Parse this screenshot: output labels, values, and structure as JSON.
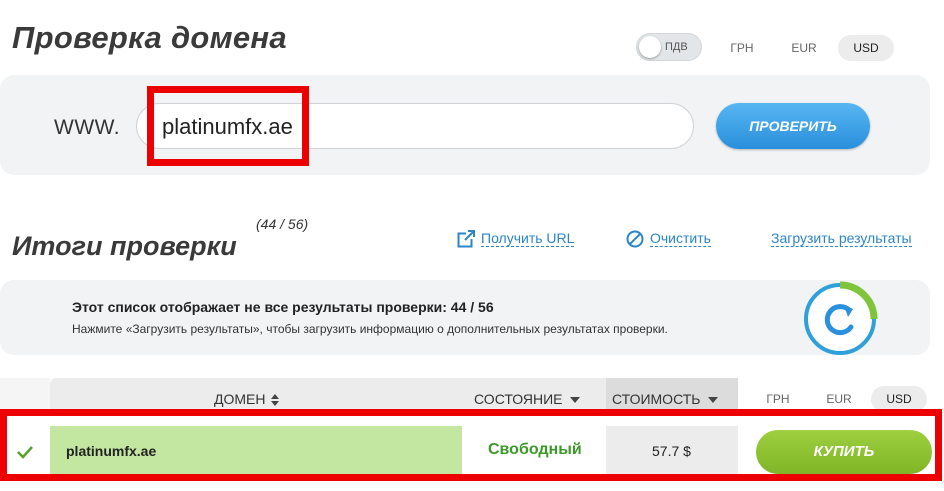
{
  "header": {
    "title": "Проверка домена",
    "vat_toggle_label": "ПДВ",
    "currencies": [
      "ГРН",
      "EUR",
      "USD"
    ],
    "active_currency": "USD"
  },
  "search": {
    "prefix": "WWW.",
    "value": "platinumfx.ae",
    "button": "ПРОВЕРИТЬ"
  },
  "results": {
    "title": "Итоги проверки",
    "count": "(44 / 56)",
    "links": {
      "get_url": "Получить URL",
      "clear": "Очистить",
      "load_results": "Загрузить результаты"
    },
    "notice_bold": "Этот список отображает не все результаты проверки: 44 / 56",
    "notice_small": "Нажмите «Загрузить результаты», чтобы загрузить информацию о дополнительных результатах проверки."
  },
  "table": {
    "columns": {
      "domain": "ДОМЕН",
      "state": "СОСТОЯНИЕ",
      "price": "СТОИМОСТЬ"
    },
    "currencies": [
      "ГРН",
      "EUR",
      "USD"
    ],
    "active_currency": "USD",
    "rows": [
      {
        "domain": "platinumfx.ae",
        "state": "Свободный",
        "price": "57.7 $",
        "action": "КУПИТЬ"
      }
    ]
  },
  "colors": {
    "highlight": "#ec0000",
    "link": "#2b86c8",
    "available": "#3c9a2a",
    "buy": "#8cc232",
    "check": "#3a9ee8"
  },
  "icons": {
    "external_link": "external-link-icon",
    "clear": "clear-icon",
    "refresh": "refresh-spinner-icon",
    "check": "checkmark-icon"
  }
}
